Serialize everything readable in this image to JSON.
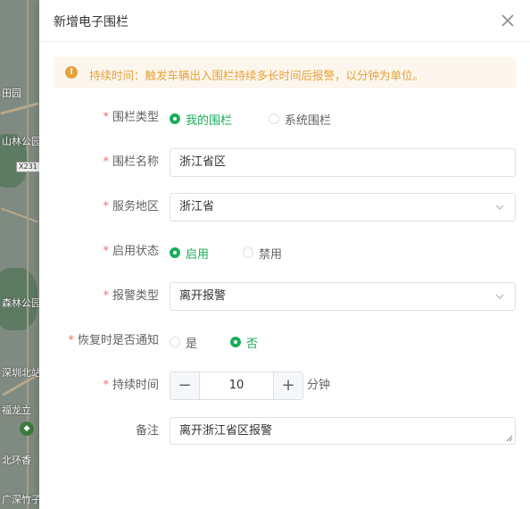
{
  "map": {
    "labels": [
      "田园",
      "山林公园",
      "X231",
      "森林公园",
      "深圳北站",
      "福龙立",
      "北环香",
      "广深竹子"
    ]
  },
  "drawer": {
    "title": "新增电子围栏",
    "alert": "持续时间：触发车辆出入围栏持续多长时间后报警，以分钟为单位。"
  },
  "form": {
    "fence_type": {
      "label": "围栏类型",
      "options": [
        "我的围栏",
        "系统围栏"
      ],
      "selected": "我的围栏"
    },
    "fence_name": {
      "label": "围栏名称",
      "value": "浙江省区"
    },
    "service_area": {
      "label": "服务地区",
      "value": "浙江省"
    },
    "status": {
      "label": "启用状态",
      "options": [
        "启用",
        "禁用"
      ],
      "selected": "启用"
    },
    "alarm_type": {
      "label": "报警类型",
      "value": "离开报警"
    },
    "notify_on_recover": {
      "label": "恢复时是否通知",
      "options": [
        "是",
        "否"
      ],
      "selected": "否"
    },
    "duration": {
      "label": "持续时间",
      "value": "10",
      "minus": "−",
      "plus": "+",
      "unit": "分钟"
    },
    "remark": {
      "label": "备注",
      "value": "离开浙江省区报警"
    }
  },
  "colors": {
    "accent": "#1aad5b",
    "required": "#f56c6c",
    "warning": "#e6a23c",
    "warning_bg": "#fdf6ec"
  }
}
